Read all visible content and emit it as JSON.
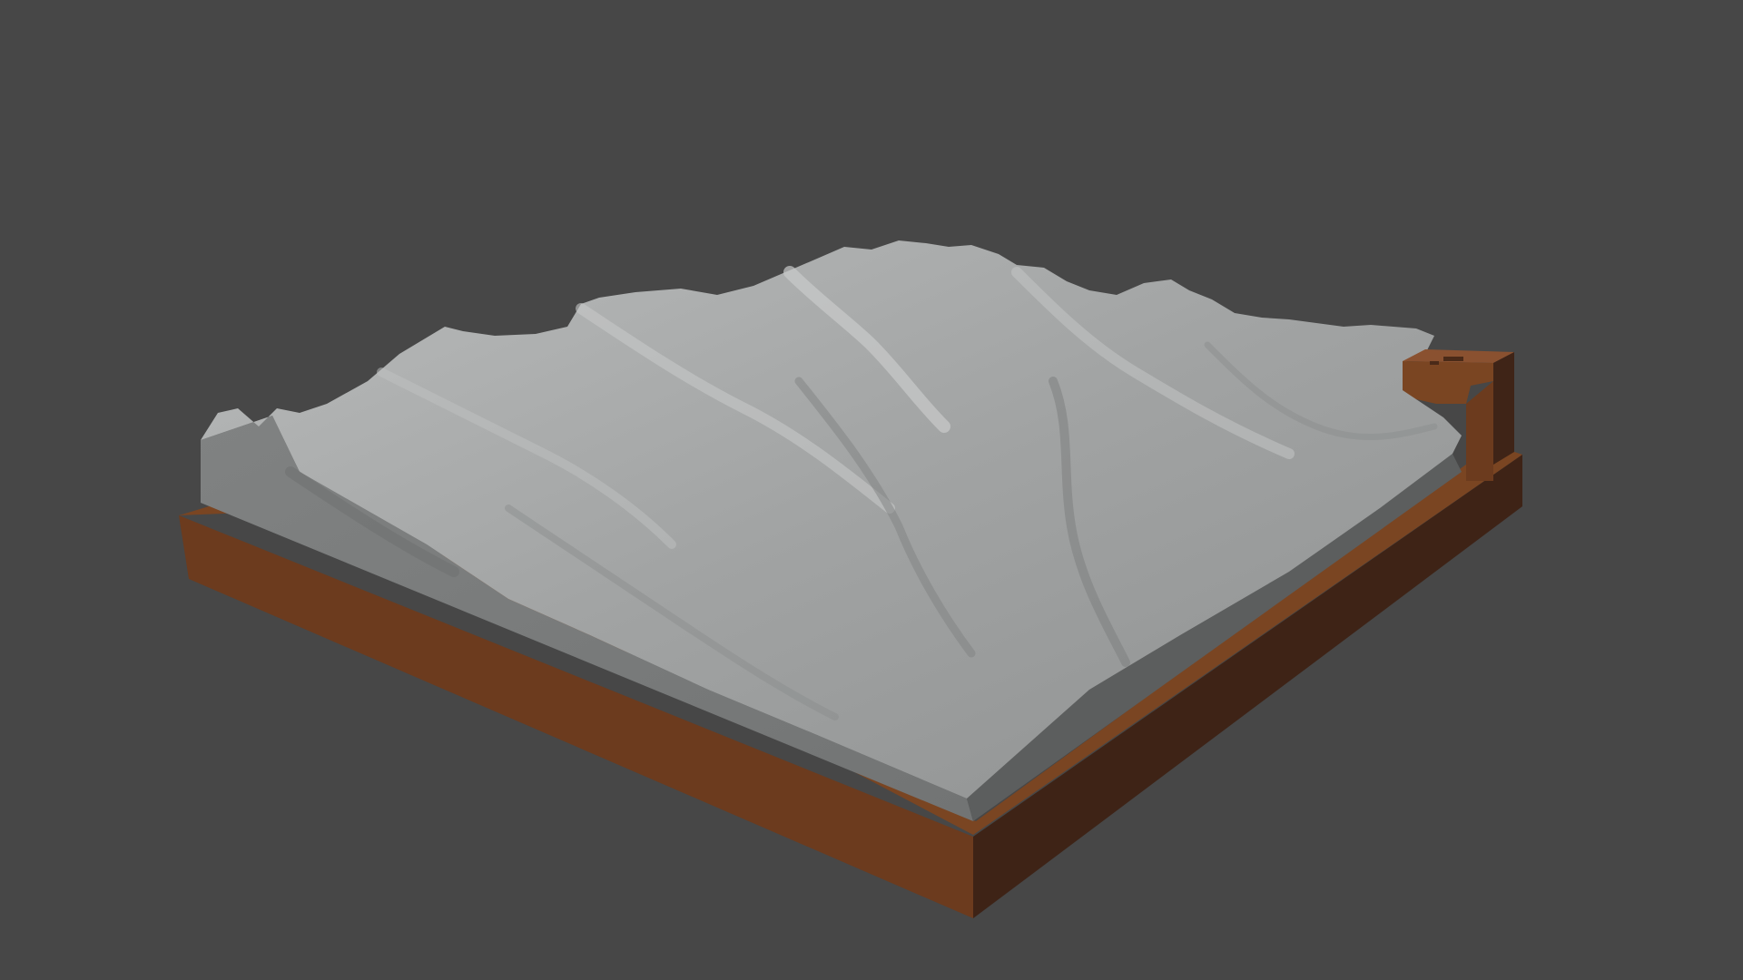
{
  "viewport": {
    "background_color": "#474747",
    "model": {
      "terrain_color": "#a3a5a5",
      "terrain_highlight_color": "#c4c6c6",
      "terrain_shadow_color": "#6c6e6e",
      "cut_face_color": "#7c7e7e",
      "base_top_color": "#7a4522",
      "base_front_color": "#6b3a1e",
      "base_side_color": "#3f2417",
      "label_block_color": "#7a4522"
    }
  }
}
